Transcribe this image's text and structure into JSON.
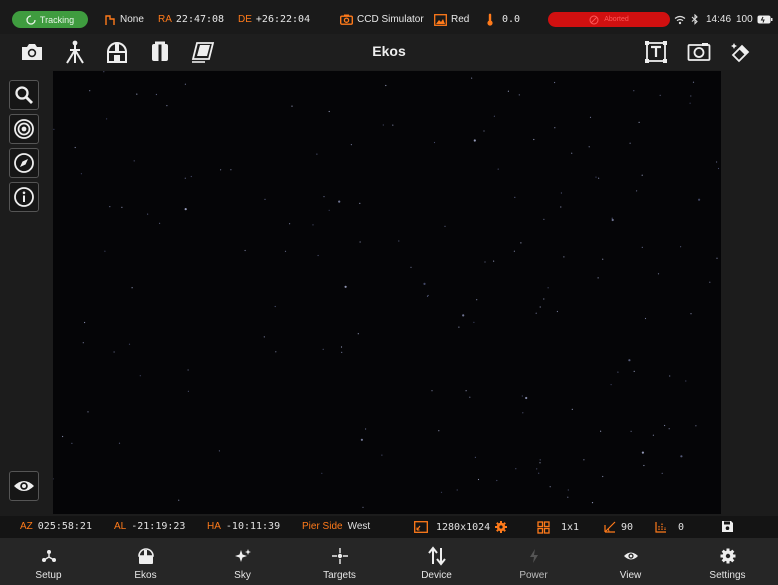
{
  "status": {
    "tracking_label": "Tracking",
    "park_value": "None",
    "ra_label": "RA",
    "ra_value": "22:47:08",
    "de_label": "DE",
    "de_value": "+26:22:04",
    "camera_name": "CCD Simulator",
    "filter_name": "Red",
    "temperature": "0.0",
    "capture_status": "Aborted",
    "time": "14:46",
    "battery": "100"
  },
  "toolbar": {
    "title": "Ekos"
  },
  "infobar": {
    "az_label": "AZ",
    "az_value": "025:58:21",
    "al_label": "AL",
    "al_value": "-21:19:23",
    "ha_label": "HA",
    "ha_value": "-10:11:39",
    "pier_label": "Pier Side",
    "pier_value": "West",
    "resolution": "1280x1024",
    "binning": "1x1",
    "rotation": "90",
    "offset": "0"
  },
  "nav": {
    "items": [
      {
        "label": "Setup",
        "icon": "setup-icon"
      },
      {
        "label": "Ekos",
        "icon": "ekos-icon"
      },
      {
        "label": "Sky",
        "icon": "sky-icon"
      },
      {
        "label": "Targets",
        "icon": "targets-icon"
      },
      {
        "label": "Device",
        "icon": "device-icon"
      },
      {
        "label": "Power",
        "icon": "power-icon"
      },
      {
        "label": "View",
        "icon": "view-icon"
      },
      {
        "label": "Settings",
        "icon": "settings-icon"
      }
    ]
  },
  "colors": {
    "accent": "#ff7a1a",
    "tracking": "#3f9c3f",
    "abort": "#d01010",
    "sky": "#050507"
  }
}
